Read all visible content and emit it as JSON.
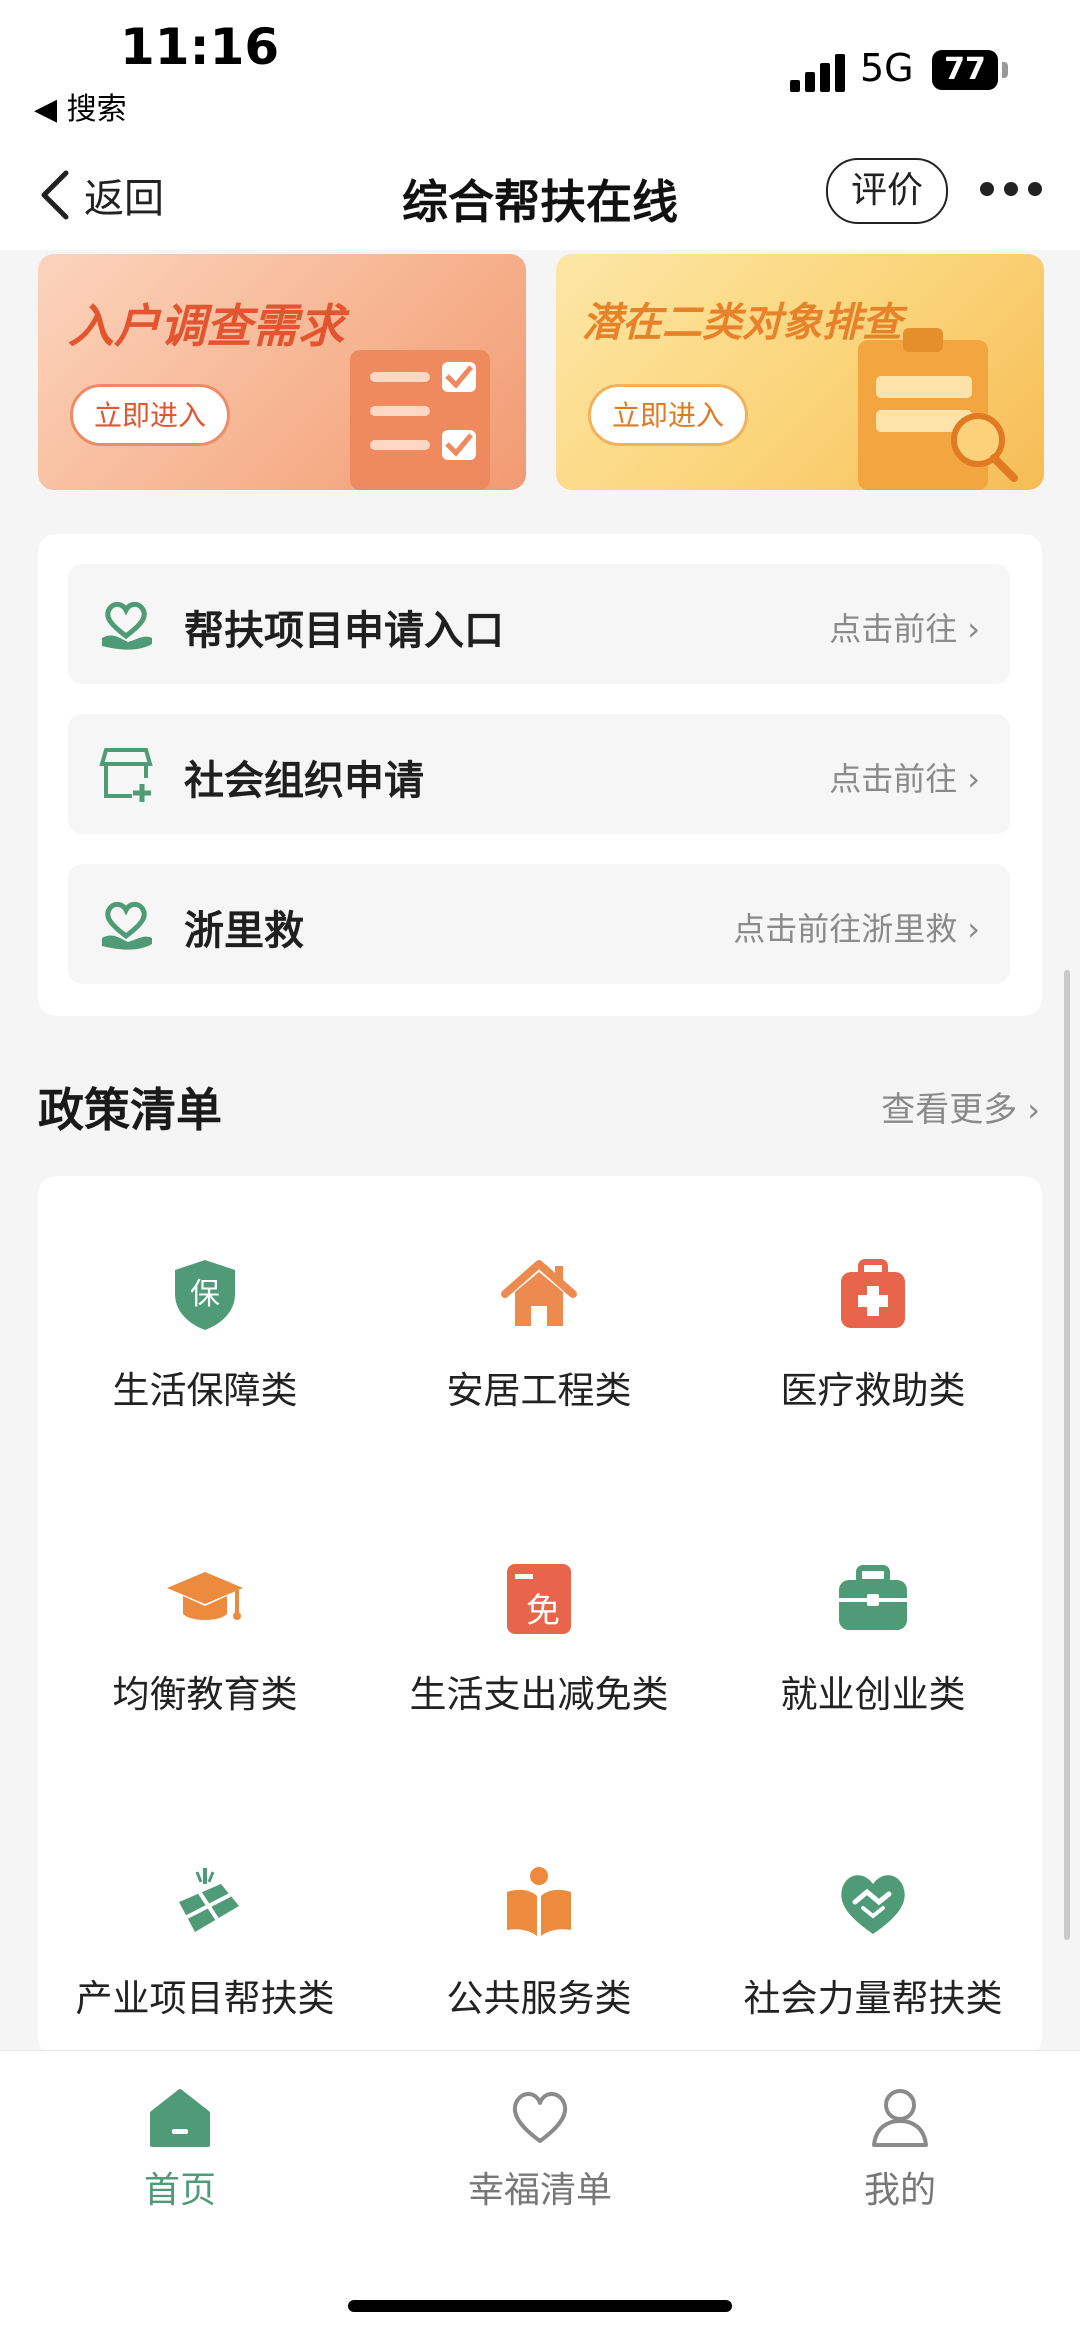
{
  "status_bar": {
    "time": "11:16",
    "back_app": "◀ 搜索",
    "network": "5G",
    "battery": "77"
  },
  "nav": {
    "back_label": "返回",
    "title": "综合帮扶在线",
    "rate_label": "评价"
  },
  "banners": [
    {
      "title": "入户调查需求",
      "button": "立即进入"
    },
    {
      "title": "潜在二类对象排查",
      "button": "立即进入"
    }
  ],
  "entries": [
    {
      "label": "帮扶项目申请入口",
      "link": "点击前往",
      "icon": "heart-hand-icon"
    },
    {
      "label": "社会组织申请",
      "link": "点击前往",
      "icon": "store-add-icon"
    },
    {
      "label": "浙里救",
      "link": "点击前往浙里救",
      "icon": "heart-hand-icon"
    }
  ],
  "policy": {
    "title": "政策清单",
    "more": "查看更多",
    "items": [
      {
        "label": "生活保障类",
        "icon": "shield-icon",
        "icon_text": "保",
        "color": "#4f9b78"
      },
      {
        "label": "安居工程类",
        "icon": "house-icon",
        "color": "#ed8a4f"
      },
      {
        "label": "医疗救助类",
        "icon": "medical-kit-icon",
        "color": "#e8654b"
      },
      {
        "label": "均衡教育类",
        "icon": "graduation-cap-icon",
        "color": "#ec8a3e"
      },
      {
        "label": "生活支出减免类",
        "icon": "exemption-icon",
        "icon_text": "免",
        "color": "#e8654b"
      },
      {
        "label": "就业创业类",
        "icon": "briefcase-icon",
        "color": "#4f9b78"
      },
      {
        "label": "产业项目帮扶类",
        "icon": "farmland-icon",
        "color": "#4f9b78"
      },
      {
        "label": "公共服务类",
        "icon": "reading-icon",
        "color": "#ec8a3e"
      },
      {
        "label": "社会力量帮扶类",
        "icon": "handshake-heart-icon",
        "color": "#4f9b78"
      }
    ]
  },
  "tabs": [
    {
      "label": "首页",
      "active": true,
      "icon": "home-icon"
    },
    {
      "label": "幸福清单",
      "active": false,
      "icon": "heart-icon"
    },
    {
      "label": "我的",
      "active": false,
      "icon": "user-icon"
    }
  ],
  "colors": {
    "accent_green": "#4f9b78",
    "orange": "#ed8a4f",
    "text_gray": "#8a8a8a"
  }
}
